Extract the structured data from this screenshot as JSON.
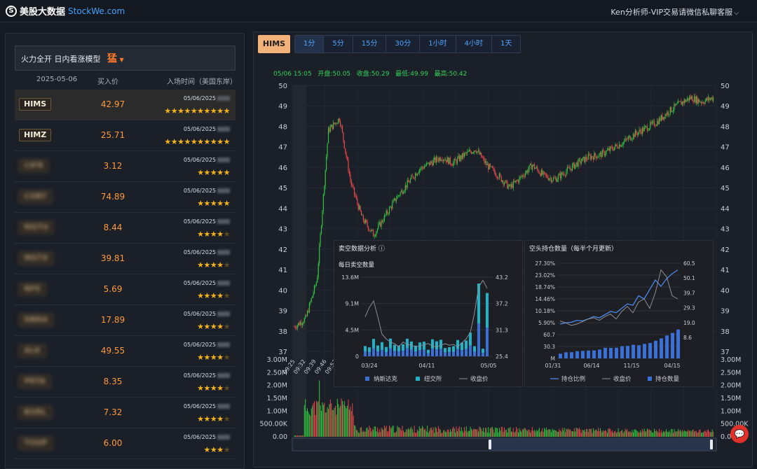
{
  "header": {
    "brand": "美股大数据",
    "site": "StockWe.com",
    "contact": "Ken分析师-VIP交易请微信私聊客服",
    "chevron_icon": "chevron-down-icon"
  },
  "left": {
    "model_label": "火力全开 日内看涨模型",
    "model_level": "猛",
    "columns": {
      "date": "2025-05-06",
      "price": "买入价",
      "time": "入场时间（美国东岸）"
    },
    "rows": [
      {
        "ticker": "HIMS",
        "price": "42.97",
        "date": "05/06/2025",
        "stars": 10,
        "blurred": false
      },
      {
        "ticker": "HIMZ",
        "price": "25.71",
        "date": "05/06/2025",
        "stars": 10,
        "blurred": false
      },
      {
        "ticker": "CIFR",
        "price": "3.12",
        "date": "05/06/2025",
        "stars": 5,
        "blurred": true
      },
      {
        "ticker": "CORT",
        "price": "74.89",
        "date": "05/06/2025",
        "stars": 5,
        "blurred": true
      },
      {
        "ticker": "MSTU",
        "price": "8.44",
        "date": "05/06/2025",
        "stars": 4,
        "blurred": true
      },
      {
        "ticker": "MSTX",
        "price": "39.81",
        "date": "05/06/2025",
        "stars": 4,
        "blurred": true
      },
      {
        "ticker": "NFE",
        "price": "5.69",
        "date": "05/06/2025",
        "stars": 4,
        "blurred": true
      },
      {
        "ticker": "DBRA",
        "price": "17.89",
        "date": "05/06/2025",
        "stars": 4,
        "blurred": true
      },
      {
        "ticker": "ALK",
        "price": "49.55",
        "date": "05/06/2025",
        "stars": 4,
        "blurred": true
      },
      {
        "ticker": "PRTA",
        "price": "8.35",
        "date": "05/06/2025",
        "stars": 4,
        "blurred": true
      },
      {
        "ticker": "BURL",
        "price": "7.32",
        "date": "05/06/2025",
        "stars": 4,
        "blurred": true
      },
      {
        "ticker": "TOUP",
        "price": "6.00",
        "date": "05/06/2025",
        "stars": 3,
        "blurred": true
      }
    ]
  },
  "right": {
    "symbol": "HIMS",
    "timeframes": [
      "1分",
      "5分",
      "15分",
      "30分",
      "1小时",
      "4小时",
      "1天"
    ],
    "active_timeframe": "1分",
    "ohlc": {
      "datetime": "05/06 15:05",
      "open_label": "开盘:",
      "open": "50.05",
      "close_label": "收盘:",
      "close": "50.29",
      "low_label": "最低:",
      "low": "49.99",
      "high_label": "最高:",
      "high": "50.42"
    },
    "price_axis": [
      "50",
      "49",
      "48",
      "47",
      "46",
      "45",
      "44",
      "43",
      "42",
      "41",
      "40",
      "39",
      "38",
      "37"
    ],
    "vol_axis": [
      "3.00M",
      "2.50M",
      "2.00M",
      "1.50M",
      "1.00M",
      "500.00K",
      "0.00"
    ],
    "time_labels": [
      "09:25",
      "09:32",
      "09:39",
      "09:46",
      "09:53"
    ],
    "short_sale": {
      "title": "卖空数据分析",
      "subtitle": "每日卖空数量",
      "y_left": [
        "13.6M",
        "9.1M",
        "4.5M",
        "0"
      ],
      "y_right": [
        "43.2",
        "37.2",
        "31.3",
        "25.4"
      ],
      "x": [
        "03/24",
        "04/11",
        "05/05"
      ],
      "legend": [
        "纳斯达克",
        "纽交所",
        "收盘价"
      ]
    },
    "short_interest": {
      "title": "空头持仓数量（每半个月更新）",
      "y_left": [
        "27.30%",
        "23.02%",
        "18.74%",
        "14.46%",
        "10.18%",
        "5.90%",
        "60.7",
        "30.3",
        "M"
      ],
      "y_right": [
        "60.5",
        "50.1",
        "39.7",
        "29.3",
        "19.0",
        "8.6"
      ],
      "x": [
        "01/31",
        "06/14",
        "11/15",
        "04/15"
      ],
      "legend": [
        "持仓比例",
        "收盘价",
        "持仓数量"
      ]
    }
  },
  "colors": {
    "up": "#2fc33f",
    "down": "#e8464a",
    "accent": "#ff9a3c",
    "tab": "#4ea6ff",
    "nasdaq": "#3a6fd8",
    "nyse": "#1fb3c9"
  },
  "chart_data": {
    "type": "line",
    "title": "HIMS",
    "ylim": [
      37,
      50
    ],
    "x": [
      "09:25",
      "09:32",
      "09:39",
      "09:46",
      "09:53"
    ],
    "series": [
      {
        "values": [
          38.2,
          38.6,
          40.5,
          47.8,
          48.4,
          45.2,
          43.5,
          42.7,
          43.6,
          44.5,
          45.2,
          45.9,
          46.2,
          46.5,
          46.2,
          46.6,
          46.9,
          46.1,
          45.6,
          45.0,
          45.5,
          46.1,
          45.6,
          45.4,
          45.8,
          46.2,
          46.5,
          46.6,
          46.9,
          47.2,
          47.6,
          47.9,
          48.2,
          48.7,
          49.1,
          49.4,
          49.2,
          49.4
        ]
      }
    ]
  }
}
